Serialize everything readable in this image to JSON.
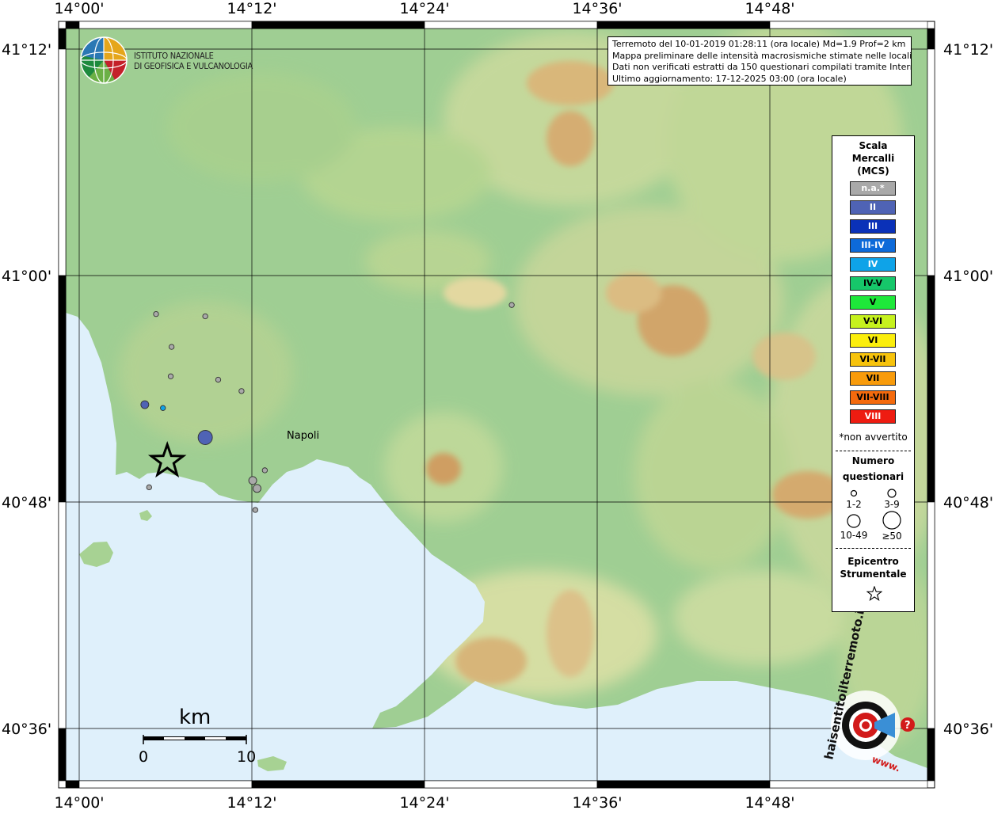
{
  "institute": {
    "line1": "ISTITUTO NAZIONALE",
    "line2": "DI GEOFISICA E VULCANOLOGIA"
  },
  "info": {
    "line1": "Terremoto del 10-01-2019 01:28:11 (ora locale) Md=1.9 Prof=2 km",
    "line2": "Mappa preliminare delle intensità macrosismiche stimate nelle località",
    "line3": "Dati non verificati estratti da 150 questionari compilati tramite Internet.",
    "line4": "Ultimo aggiornamento: 17-12-2025 03:00 (ora locale)"
  },
  "axes": {
    "lon_labels": [
      "14°00'",
      "14°12'",
      "14°24'",
      "14°36'",
      "14°48'"
    ],
    "lat_labels": [
      "41°12'",
      "41°00'",
      "40°48'",
      "40°36'"
    ]
  },
  "city": {
    "label": "Napoli"
  },
  "scalebar": {
    "title": "km",
    "start": "0",
    "end": "10"
  },
  "legend": {
    "title1": "Scala",
    "title2": "Mercalli",
    "title3": "(MCS)",
    "intensities": [
      {
        "label": "n.a.*",
        "color": "#a9a9a9",
        "text": "#ffffff"
      },
      {
        "label": "II",
        "color": "#4f63b5",
        "text": "#ffffff"
      },
      {
        "label": "III",
        "color": "#0a31b8",
        "text": "#ffffff"
      },
      {
        "label": "III-IV",
        "color": "#0d6ad9",
        "text": "#ffffff"
      },
      {
        "label": "IV",
        "color": "#0ea3e8",
        "text": "#ffffff"
      },
      {
        "label": "IV-V",
        "color": "#16c76a",
        "text": "#000000"
      },
      {
        "label": "V",
        "color": "#1ee83a",
        "text": "#000000"
      },
      {
        "label": "V-VI",
        "color": "#c6f21d",
        "text": "#000000"
      },
      {
        "label": "VI",
        "color": "#fbee0c",
        "text": "#000000"
      },
      {
        "label": "VI-VII",
        "color": "#f7c30c",
        "text": "#000000"
      },
      {
        "label": "VII",
        "color": "#f89b0b",
        "text": "#000000"
      },
      {
        "label": "VII-VIII",
        "color": "#f46a0d",
        "text": "#000000"
      },
      {
        "label": "VIII",
        "color": "#ee1c11",
        "text": "#ffffff"
      }
    ],
    "not_felt_note": "*non avvertito",
    "count_title1": "Numero",
    "count_title2": "questionari",
    "counts": [
      "1-2",
      "3-9",
      "10-49",
      "≥50"
    ],
    "epicenter_title1": "Epicentro",
    "epicenter_title2": "Strumentale"
  },
  "observations": [
    {
      "lon": 14.089,
      "lat": 40.966,
      "intensity": "n.a.*",
      "size_class": "1-2"
    },
    {
      "lon": 14.146,
      "lat": 40.964,
      "intensity": "n.a.*",
      "size_class": "1-2"
    },
    {
      "lon": 14.501,
      "lat": 40.974,
      "intensity": "n.a.*",
      "size_class": "1-2"
    },
    {
      "lon": 14.107,
      "lat": 40.937,
      "intensity": "n.a.*",
      "size_class": "1-2"
    },
    {
      "lon": 14.106,
      "lat": 40.911,
      "intensity": "n.a.*",
      "size_class": "1-2"
    },
    {
      "lon": 14.161,
      "lat": 40.908,
      "intensity": "n.a.*",
      "size_class": "1-2"
    },
    {
      "lon": 14.188,
      "lat": 40.898,
      "intensity": "n.a.*",
      "size_class": "1-2"
    },
    {
      "lon": 14.215,
      "lat": 40.828,
      "intensity": "n.a.*",
      "size_class": "1-2"
    },
    {
      "lon": 14.206,
      "lat": 40.812,
      "intensity": "n.a.*",
      "size_class": "3-9"
    },
    {
      "lon": 14.204,
      "lat": 40.793,
      "intensity": "n.a.*",
      "size_class": "1-2"
    },
    {
      "lon": 14.201,
      "lat": 40.819,
      "intensity": "n.a.*",
      "size_class": "3-9"
    },
    {
      "lon": 14.081,
      "lat": 40.813,
      "intensity": "n.a.*",
      "size_class": "1-2"
    },
    {
      "lon": 14.076,
      "lat": 40.886,
      "intensity": "II",
      "size_class": "3-9"
    },
    {
      "lon": 14.097,
      "lat": 40.883,
      "intensity": "IV",
      "size_class": "1-2"
    },
    {
      "lon": 14.146,
      "lat": 40.857,
      "intensity": "II",
      "size_class": "10-49"
    }
  ],
  "epicenter": {
    "lon": 14.102,
    "lat": 40.836
  },
  "brand": {
    "text": "haisentitoilterremoto.it",
    "url_text": "www.",
    "question_mark": "?"
  }
}
